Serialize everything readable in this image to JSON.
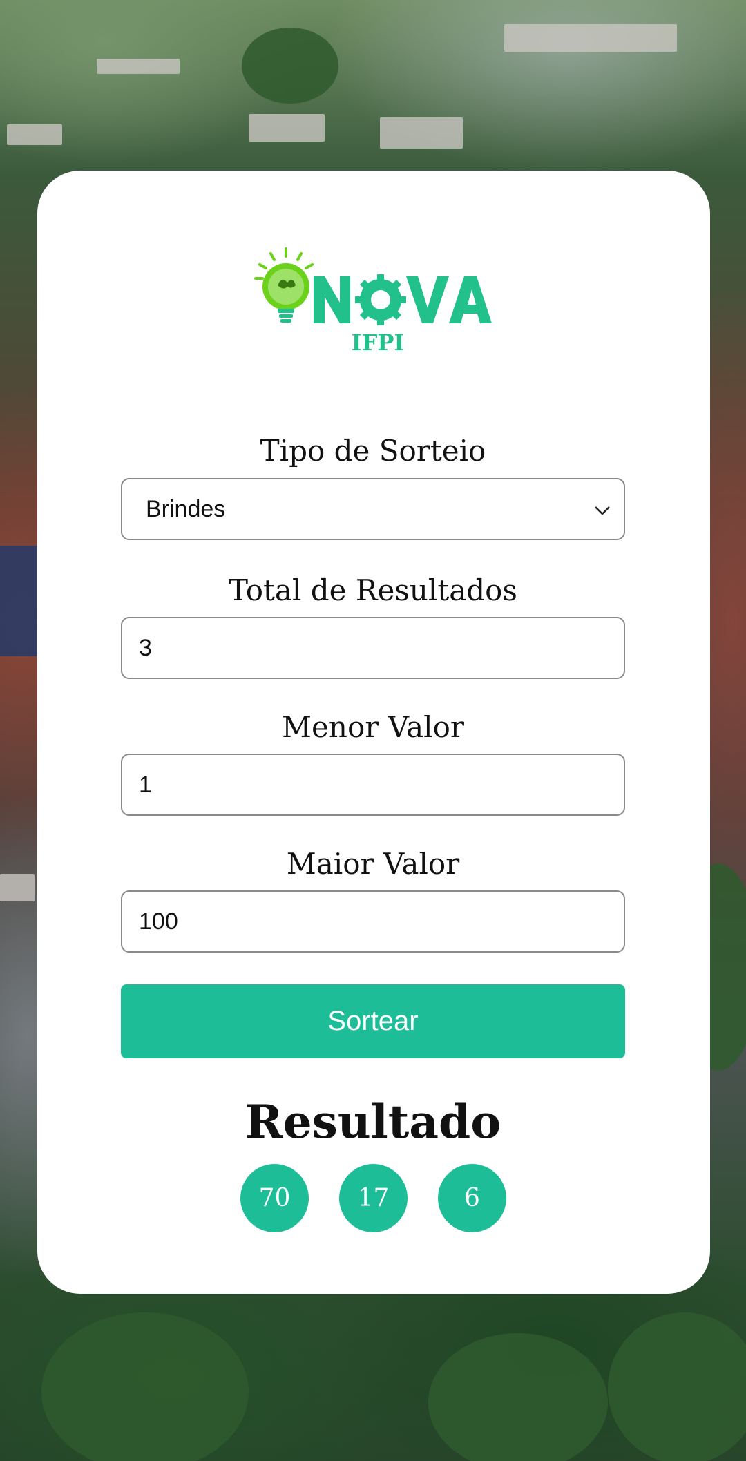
{
  "app": {
    "logo_text": "INOVA",
    "logo_subtext": "IFPI"
  },
  "form": {
    "tipo_label": "Tipo de Sorteio",
    "tipo_value": "Brindes",
    "total_label": "Total de Resultados",
    "total_value": "3",
    "menor_label": "Menor Valor",
    "menor_value": "1",
    "maior_label": "Maior Valor",
    "maior_value": "100",
    "submit_label": "Sortear"
  },
  "result": {
    "title": "Resultado",
    "numbers": [
      "70",
      "17",
      "6"
    ]
  },
  "colors": {
    "accent": "#1cbd97",
    "logo_green": "#22c08a",
    "bulb_green": "#6bd11a"
  }
}
